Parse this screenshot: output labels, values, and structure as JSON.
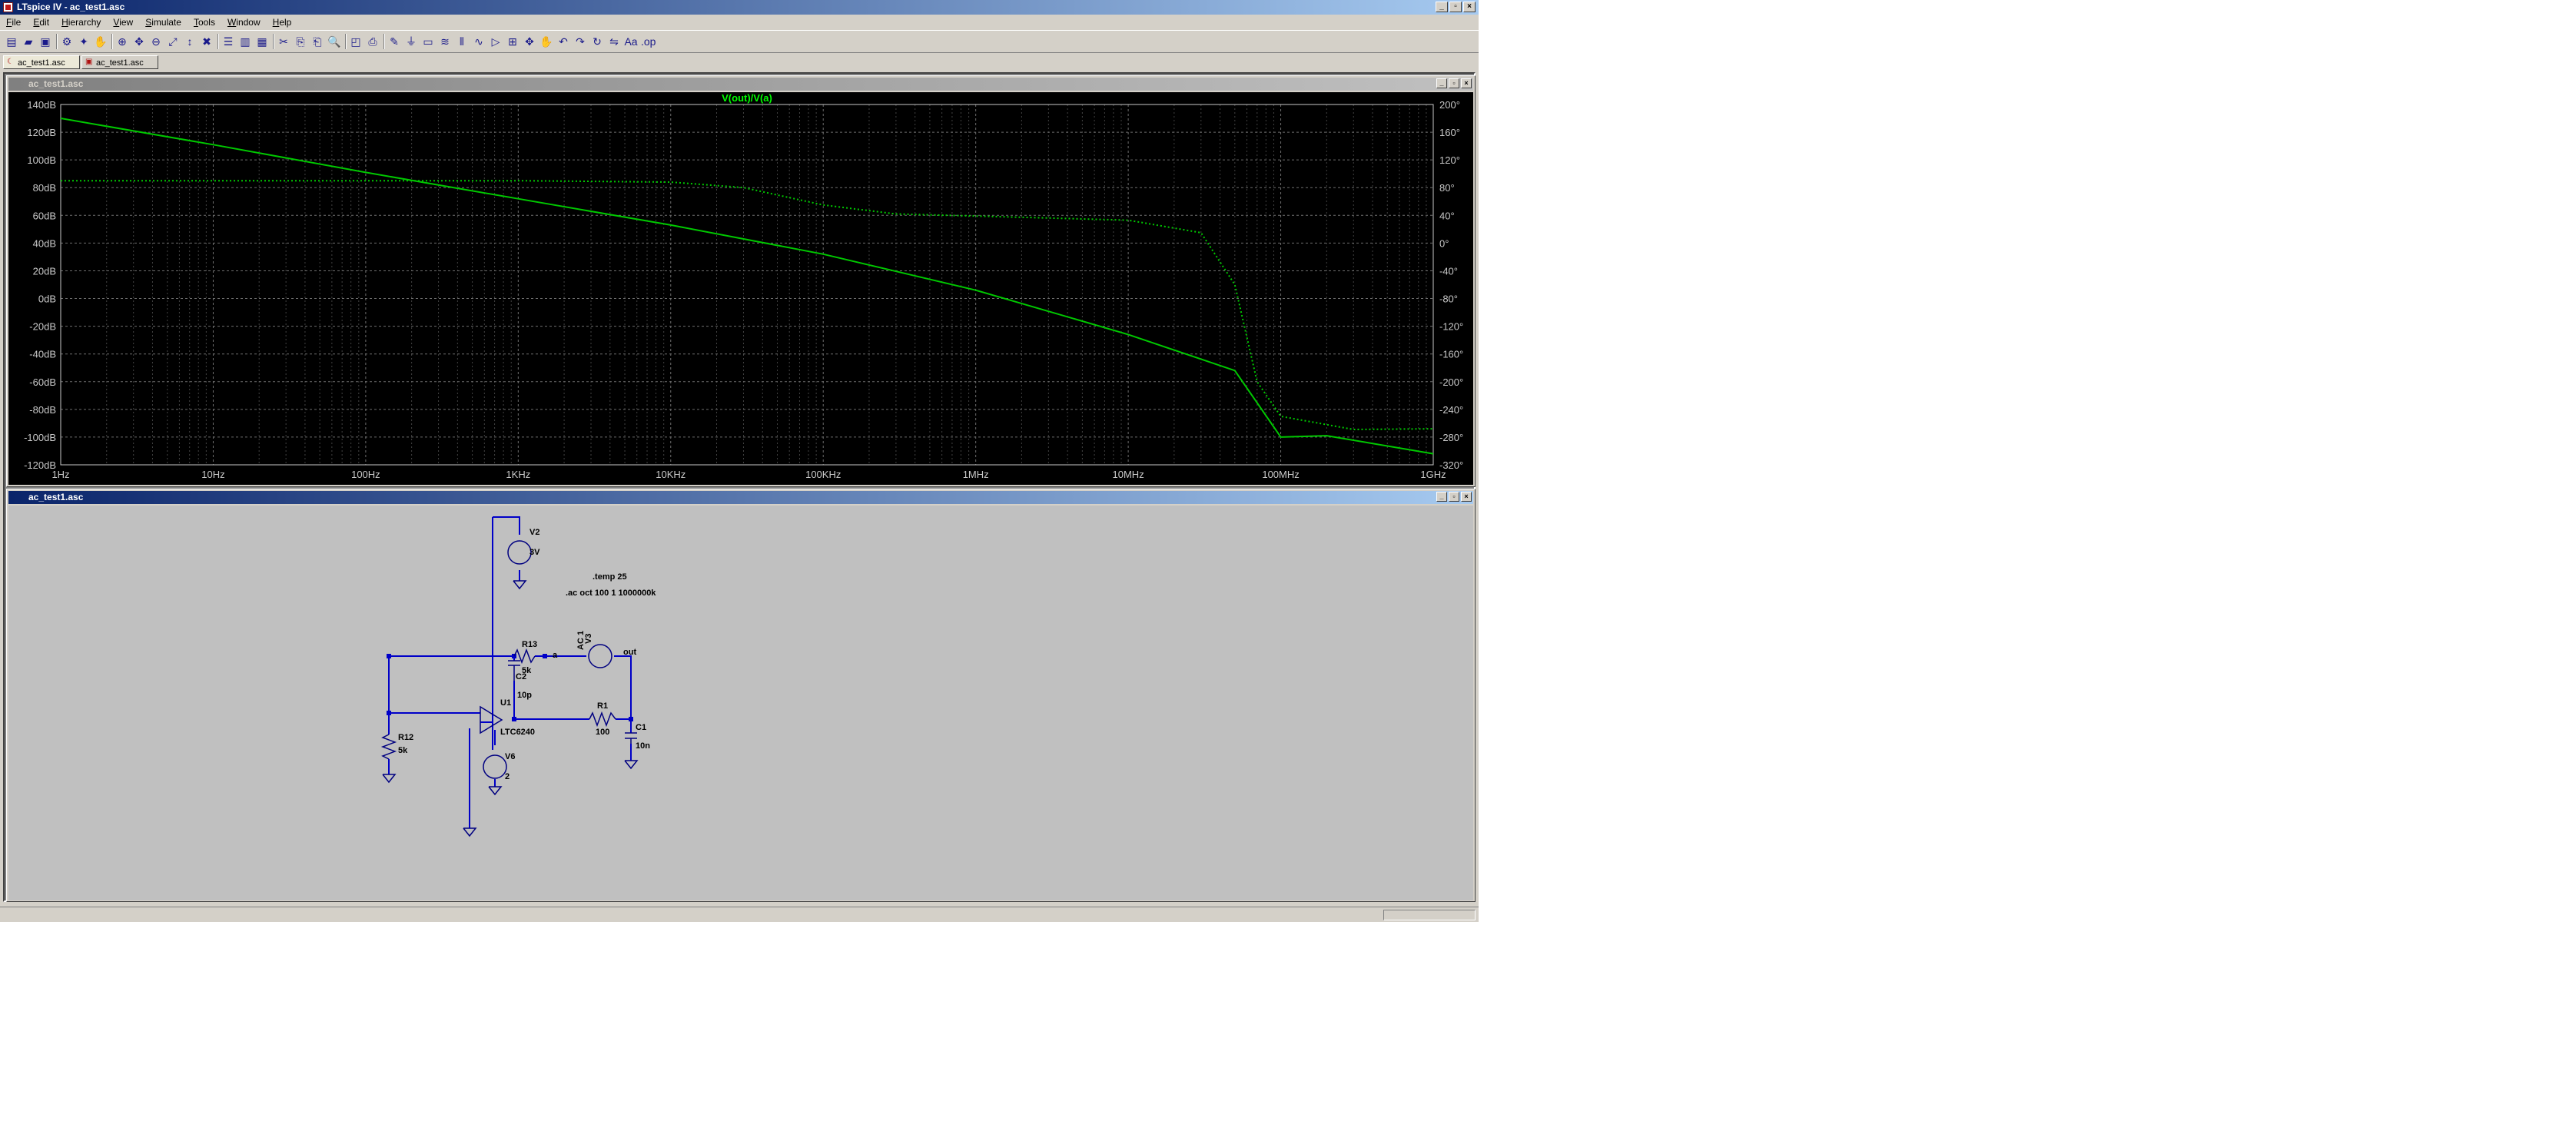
{
  "app": {
    "title": "LTspice IV - ac_test1.asc"
  },
  "menu": [
    "File",
    "Edit",
    "Hierarchy",
    "View",
    "Simulate",
    "Tools",
    "Window",
    "Help"
  ],
  "toolbar": {
    "icons": [
      "new-schematic-icon",
      "open-icon",
      "save-icon",
      "control-panel-icon",
      "run-icon",
      "halt-icon",
      "zoom-in-icon",
      "zoom-pan-icon",
      "zoom-out-icon",
      "zoom-fit-icon",
      "autorange-icon",
      "mark-unconnected-icon",
      "tile-horizontal-icon",
      "tile-vertical-icon",
      "cascade-icon",
      "cut-icon",
      "copy-icon",
      "paste-icon",
      "find-icon",
      "print-preview-icon",
      "print-icon",
      "wire-icon",
      "ground-icon",
      "label-net-icon",
      "resistor-icon",
      "capacitor-icon",
      "inductor-icon",
      "diode-icon",
      "component-icon",
      "move-icon",
      "drag-icon",
      "undo-icon",
      "redo-icon",
      "rotate-icon",
      "mirror-icon",
      "text-icon",
      "spice-directive-icon"
    ]
  },
  "tabs": [
    {
      "label": "ac_test1.asc",
      "active": true
    },
    {
      "label": "ac_test1.asc",
      "active": false
    }
  ],
  "plot_window": {
    "title": "ac_test1.asc",
    "trace_label": "V(out)/V(a)",
    "colors": {
      "background": "#000000",
      "trace": "#00c800",
      "grid": "#6e6e6e",
      "axis_text": "#c8c8c8",
      "title": "#00ff00"
    }
  },
  "chart_data": {
    "type": "line",
    "title": "V(out)/V(a)",
    "x_scale": "log",
    "x_ticks": [
      "1Hz",
      "10Hz",
      "100Hz",
      "1KHz",
      "10KHz",
      "100KHz",
      "1MHz",
      "10MHz",
      "100MHz",
      "1GHz"
    ],
    "xlim": [
      1,
      1000000000
    ],
    "y_left_ticks": [
      "140dB",
      "120dB",
      "100dB",
      "80dB",
      "60dB",
      "40dB",
      "20dB",
      "0dB",
      "-20dB",
      "-40dB",
      "-60dB",
      "-80dB",
      "-100dB",
      "-120dB"
    ],
    "ylim_left": [
      -120,
      140
    ],
    "y_right_ticks": [
      "200°",
      "160°",
      "120°",
      "80°",
      "40°",
      "0°",
      "-40°",
      "-80°",
      "-120°",
      "-160°",
      "-200°",
      "-240°",
      "-280°",
      "-320°"
    ],
    "ylim_right": [
      -320,
      200
    ],
    "grid": true,
    "series": [
      {
        "name": "magnitude",
        "style": "solid",
        "axis": "left",
        "x": [
          1,
          10,
          100,
          1000,
          10000,
          100000,
          1000000,
          10000000,
          50000000,
          100000000,
          200000000,
          1000000000
        ],
        "y": [
          130,
          111,
          91,
          72,
          53,
          32,
          6,
          -26,
          -52,
          -100,
          -99,
          -112
        ]
      },
      {
        "name": "phase",
        "style": "dotted",
        "axis": "right",
        "x": [
          1,
          10,
          100,
          1000,
          10000,
          30000,
          100000,
          300000,
          1000000,
          10000000,
          30000000,
          50000000,
          70000000,
          100000000,
          300000000,
          1000000000
        ],
        "y": [
          90,
          90,
          90,
          90,
          88,
          80,
          55,
          42,
          39,
          33,
          15,
          -60,
          -200,
          -250,
          -269,
          -268
        ]
      }
    ]
  },
  "schematic_window": {
    "title": "ac_test1.asc",
    "colors": {
      "background": "#c0c0c0",
      "wire": "#0000c8",
      "component": "#000080",
      "text": "#000000"
    },
    "directives": [
      ".temp 25",
      ".ac oct 100 1 1000000k"
    ],
    "components": {
      "V2": {
        "name": "V2",
        "value": "3V"
      },
      "R13": {
        "name": "R13",
        "value": "5k"
      },
      "C2": {
        "name": "C2",
        "value": "10p"
      },
      "R12": {
        "name": "R12",
        "value": "5k"
      },
      "U1": {
        "name": "U1",
        "value": "LTC6240"
      },
      "V6": {
        "name": "V6",
        "value": "2"
      },
      "R1": {
        "name": "R1",
        "value": "100"
      },
      "C1": {
        "name": "C1",
        "value": "10n"
      },
      "V3": {
        "name": "V3",
        "value": "AC 1"
      }
    },
    "net_labels": {
      "a": "a",
      "out": "out"
    }
  }
}
